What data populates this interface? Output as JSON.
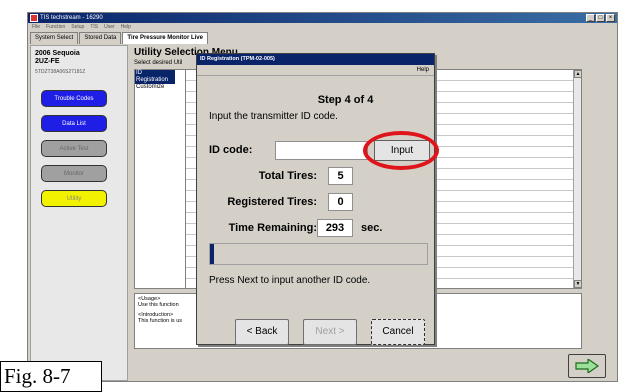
{
  "window": {
    "title": "TIS techstream - 16290",
    "menus": [
      "File",
      "Function",
      "Setup",
      "TIS",
      "User",
      "Help"
    ]
  },
  "tabs": [
    {
      "label": "System Select"
    },
    {
      "label": "Stored Data"
    },
    {
      "label": "Tire Pressure Monitor Live"
    }
  ],
  "vehicle": {
    "name": "2006 Sequoia",
    "engine": "2UZ-FE",
    "vin": "5TDZT38A06S27181Z"
  },
  "side_buttons": [
    {
      "label": "Trouble Codes"
    },
    {
      "label": "Data List"
    },
    {
      "label": "Active Test"
    },
    {
      "label": "Monitor"
    },
    {
      "label": "Utility"
    }
  ],
  "main": {
    "heading": "Utility Selection Menu",
    "subheading": "Select desired Util",
    "list_items": [
      "ID Registration",
      "Customize"
    ],
    "usage_label": "<Usage>",
    "usage_text": "Use this function",
    "intro_label": "<Introduction>",
    "intro_text": "This function is us"
  },
  "dialog": {
    "title": "ID Registration (TPM-02-005)",
    "help": "Help",
    "step": "Step 4 of 4",
    "instruction": "Input the transmitter ID code.",
    "id_code_label": "ID code:",
    "id_code_value": "",
    "input_button": "Input",
    "total_tires_label": "Total Tires:",
    "total_tires_value": "5",
    "registered_tires_label": "Registered Tires:",
    "registered_tires_value": "0",
    "time_remaining_label": "Time Remaining:",
    "time_remaining_value": "293",
    "time_unit": "sec.",
    "progress_fraction": 0.02,
    "hint": "Press Next to input another ID code.",
    "back_button": "< Back",
    "next_button": "Next >",
    "cancel_button": "Cancel"
  },
  "highlight_color": "#e0141b",
  "caption": "Fig. 8-7"
}
